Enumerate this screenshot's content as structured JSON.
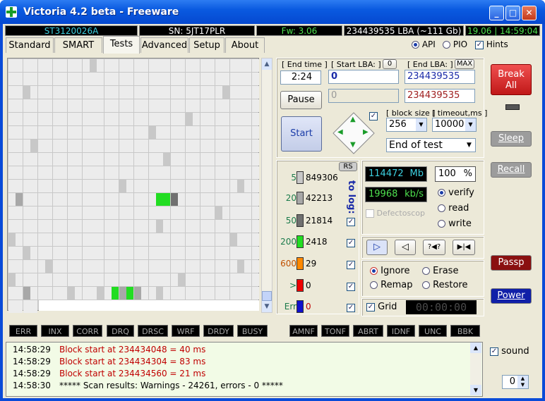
{
  "window": {
    "title": "Victoria 4.2 beta - Freeware",
    "min": "_",
    "max": "□",
    "close": "✕"
  },
  "infobar": {
    "model": "ST3120026A",
    "serial": "SN: 5JT17PLR",
    "firmware": "Fw: 3.06",
    "lba": "234439535 LBA (~111 Gb)",
    "clock": "19.06 | 14:59:04"
  },
  "tabs": [
    "Standard",
    "SMART",
    "Tests",
    "Advanced",
    "Setup",
    "About"
  ],
  "mode": {
    "api": "API",
    "pio": "PIO",
    "hints": "Hints"
  },
  "test": {
    "end_time_label": "[ End time ]",
    "end_time": "2:24",
    "start_lba_label": "[ Start LBA: ]",
    "start_lba_zero": "0",
    "start_lba": "0",
    "end_lba_label": "[ End LBA: ]",
    "end_lba_max": "MAX",
    "end_lba": "234439535",
    "cur_lba": "0",
    "cur_end": "234439535",
    "pause": "Pause",
    "start": "Start",
    "block_size_label": "[ block size ]",
    "block_size": "256",
    "timeout_label": "[ timeout,ms ]",
    "timeout": "10000",
    "end_action": "End of test"
  },
  "legend": {
    "rs": "RS",
    "to_log": "to log:",
    "rows": [
      {
        "label": "5",
        "count": "849306",
        "color": "#c8c8c8"
      },
      {
        "label": "20",
        "count": "42213",
        "color": "#a8a8a8"
      },
      {
        "label": "50",
        "count": "21814",
        "color": "#707070"
      },
      {
        "label": "200",
        "count": "2418",
        "color": "#22dd22"
      },
      {
        "label": "600",
        "count": "29",
        "color": "#ff8800"
      },
      {
        "label": ">",
        "count": "0",
        "color": "#ee0000"
      },
      {
        "label": "Err",
        "count": "0",
        "color": "#1010cc"
      }
    ]
  },
  "readout": {
    "mb": "114472",
    "mb_unit": "Mb",
    "percent": "100",
    "percent_unit": "%",
    "speed": "19968",
    "speed_unit": "kb/s",
    "defectoscop": "Defectoscop"
  },
  "verify": {
    "verify": "verify",
    "read": "read",
    "write": "write"
  },
  "playback": [
    "▷",
    "◁",
    "?◀?",
    "▶|◀"
  ],
  "actions": {
    "ignore": "Ignore",
    "erase": "Erase",
    "remap": "Remap",
    "restore": "Restore"
  },
  "grid_label": "Grid",
  "timer": "00:00:00",
  "right": {
    "break": "Break All",
    "sleep": "Sleep",
    "recall": "Recall",
    "passp": "Passp",
    "power": "Power"
  },
  "status": [
    "ERR",
    "INX",
    "CORR",
    "DRQ",
    "DRSC",
    "WRF",
    "DRDY",
    "BUSY",
    "AMNF",
    "TONF",
    "ABRT",
    "IDNF",
    "UNC",
    "BBK"
  ],
  "log": [
    {
      "time": "14:58:29",
      "text": "Block start at 234434048 = 40 ms",
      "color": "#c00000"
    },
    {
      "time": "14:58:29",
      "text": "Block start at 234434304 = 83 ms",
      "color": "#c00000"
    },
    {
      "time": "14:58:29",
      "text": "Block start at 234434560 = 21 ms",
      "color": "#c00000"
    },
    {
      "time": "14:58:30",
      "text": "***** Scan results: Warnings - 24261, errors - 0 *****",
      "color": "#000000"
    }
  ],
  "sound": {
    "label": "sound",
    "value": "0"
  }
}
